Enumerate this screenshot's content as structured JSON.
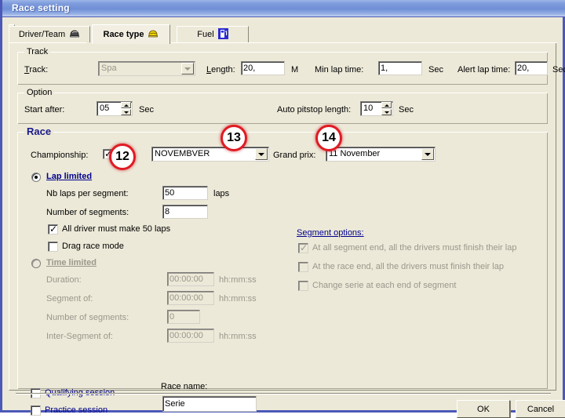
{
  "window": {
    "title": "Race setting"
  },
  "tabs": [
    {
      "label": "Driver/Team",
      "icon": "helmet-grey-icon",
      "active": false
    },
    {
      "label": "Race type",
      "icon": "helmet-yellow-icon",
      "active": true
    },
    {
      "label": "Fuel",
      "icon": "fuel-pump-icon",
      "active": false
    }
  ],
  "track_group": {
    "title": "Track",
    "track_label": "Track:",
    "track_value": "Spa",
    "length_label": "Length:",
    "length_value": "20,",
    "length_unit": "M",
    "min_lap_label": "Min lap time:",
    "min_lap_value": "1,",
    "min_lap_unit": "Sec",
    "alert_lap_label": "Alert lap time:",
    "alert_lap_value": "20,",
    "alert_lap_unit": "Sec"
  },
  "option_group": {
    "title": "Option",
    "start_after_label": "Start after:",
    "start_after_value": "05",
    "start_after_unit": "Sec",
    "auto_pitstop_label": "Auto pitstop length:",
    "auto_pitstop_value": "10",
    "auto_pitstop_unit": "Sec"
  },
  "race_group": {
    "title": "Race",
    "championship_label": "Championship:",
    "championship_checked": true,
    "championship_value": "NOVEMBVER",
    "grand_prix_label": "Grand prix:",
    "grand_prix_value": "11 November",
    "lap_limited": {
      "label": "Lap limited",
      "selected": true,
      "nb_laps_label": "Nb laps per segment:",
      "nb_laps_value": "50",
      "nb_laps_unit": "laps",
      "nb_segments_label": "Number of segments:",
      "nb_segments_value": "8",
      "all_driver_label": "All driver must make 50 laps",
      "all_driver_checked": true,
      "drag_race_label": "Drag race mode",
      "drag_race_checked": false
    },
    "time_limited": {
      "label": "Time limited",
      "selected": false,
      "duration_label": "Duration:",
      "duration_value": "00:00:00",
      "duration_unit": "hh:mm:ss",
      "segment_of_label": "Segment of:",
      "segment_of_value": "00:00:00",
      "segment_of_unit": "hh:mm:ss",
      "nb_segments_label": "Number of segments:",
      "nb_segments_value": "0",
      "inter_segment_label": "Inter-Segment of:",
      "inter_segment_value": "00:00:00",
      "inter_segment_unit": "hh:mm:ss"
    },
    "segment_options": {
      "title": "Segment options:",
      "items": [
        {
          "label": "At all segment end, all the drivers must finish their lap",
          "checked": true
        },
        {
          "label": "At the race end, all the drivers must finish their lap",
          "checked": false
        },
        {
          "label": "Change serie at each end of segment",
          "checked": false
        }
      ]
    },
    "qualifying_label": "Qualifying session",
    "qualifying_checked": false,
    "practice_label": "Practice session",
    "practice_checked": false,
    "race_name_label": "Race name:",
    "race_name_value": "Serie"
  },
  "buttons": {
    "ok": "OK",
    "cancel": "Cancel"
  },
  "annotations": [
    {
      "number": "12"
    },
    {
      "number": "13"
    },
    {
      "number": "14"
    }
  ],
  "colors": {
    "titlebar_blue": "#6f8fd6",
    "window_border": "#4c59b8",
    "face": "#ece9d8",
    "link_navy": "#00008b",
    "annotation_red": "#e01b24"
  }
}
